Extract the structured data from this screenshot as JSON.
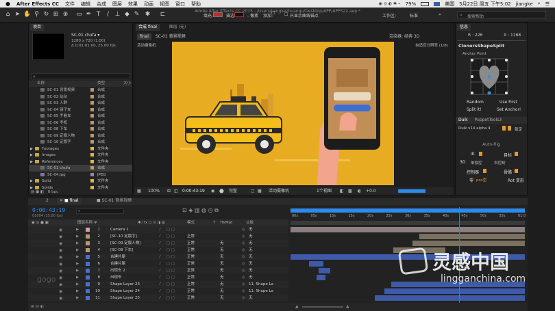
{
  "menubar": {
    "apple": "",
    "app": "After Effects CC",
    "items": [
      "文件",
      "编辑",
      "合成",
      "图层",
      "效果",
      "动画",
      "视图",
      "窗口",
      "帮助"
    ],
    "battery": "79%",
    "lang": "美国",
    "datetime": "5月22日 周五 下午5:02",
    "user": "jiangke"
  },
  "toolbar": {
    "doc_path": "Adobe After Effects CC 2015 - /Users/jiangkezhuanqu/Desktop/APP/APP522.aep *",
    "fill_label": "填充:",
    "stroke_label": "描边:",
    "stroke_px": "- 像素",
    "add_label": "添加:",
    "rtl_label": "只显示曲线锚点",
    "workspace_label": "工作区:",
    "workspace_value": "标准",
    "search_placeholder": "搜索帮助"
  },
  "project": {
    "tab": "项目",
    "comp_name": "SC-01 chufa ▾",
    "comp_res": "1280 x 720 (1.00)",
    "comp_dur": "Δ 0:01:01:00, 25.00 fps",
    "col_name": "名称",
    "col_type": "类型",
    "col_size": "大小",
    "items": [
      {
        "name": "SC-01 背景视频",
        "type": "合成",
        "color": "#b89a6d",
        "kind": "comp"
      },
      {
        "name": "SC-02 站台",
        "type": "合成",
        "color": "#b89a6d",
        "kind": "comp"
      },
      {
        "name": "SC-03 人群",
        "type": "合成",
        "color": "#b89a6d",
        "kind": "comp"
      },
      {
        "name": "SC-04 骑子女",
        "type": "合成",
        "color": "#b89a6d",
        "kind": "comp"
      },
      {
        "name": "SC-05 手看车",
        "type": "合成",
        "color": "#b89a6d",
        "kind": "comp"
      },
      {
        "name": "SC-06 手机",
        "type": "合成",
        "color": "#b89a6d",
        "kind": "comp"
      },
      {
        "name": "SC-08 下车",
        "type": "合成",
        "color": "#b89a6d",
        "kind": "comp"
      },
      {
        "name": "SC-09 定版人物",
        "type": "合成",
        "color": "#b89a6d",
        "kind": "comp"
      },
      {
        "name": "SC-10 定版字",
        "type": "合成",
        "color": "#b89a6d",
        "kind": "comp"
      },
      {
        "name": "Footages",
        "type": "文件夹",
        "color": "#d9b84c",
        "kind": "folder"
      },
      {
        "name": "Images",
        "type": "文件夹",
        "color": "#d9b84c",
        "kind": "folder"
      },
      {
        "name": "References",
        "type": "文件夹",
        "color": "#d9b84c",
        "kind": "folder"
      },
      {
        "name": "SC-01 chufa",
        "type": "合成",
        "color": "#b89a6d",
        "kind": "comp",
        "selected": true
      },
      {
        "name": "SC-04.jpg",
        "type": "JPEG",
        "color": "#8a8aa8",
        "kind": "file"
      },
      {
        "name": "Solid",
        "type": "文件夹",
        "color": "#d9b84c",
        "kind": "folder"
      },
      {
        "name": "Solids",
        "type": "文件夹",
        "color": "#d9b84c",
        "kind": "folder"
      }
    ],
    "bpc": "8 bpc"
  },
  "composition": {
    "tab_prefix": "合成",
    "tab_name": "final",
    "layer_tab": "图层 (无)",
    "chip": "final",
    "breadcrumb": "SC-01 背景视频",
    "renderer_label": "渲染器:",
    "renderer_value": "经典 3D",
    "camera": "活动摄像机",
    "resolution": "自适应分辨率 (1/8)",
    "zoom": "100%",
    "timecode": "0:00:43:19",
    "res": "完整",
    "view_camera": "活动摄像机",
    "views": "1个视图",
    "exposure": "+0.0"
  },
  "info": {
    "tab": "信息",
    "r": "R : 226",
    "x": "X : 1168"
  },
  "clonershape": {
    "title": "ClonersShapeSplit",
    "anchor_label": "Anchor Point",
    "random": "Random",
    "use_first": "Use First",
    "split_it": "Split it!",
    "set_anchor": "Set Anchor!"
  },
  "duik": {
    "tab_duik": "Duik",
    "tab_puppet": "PuppetTools3",
    "version": "Duik v14 alpha 4",
    "auto_rig": "Auto-Rig",
    "ik": "IK",
    "target": "目标",
    "three_d": "3D",
    "rig_left": "单独控",
    "rig_right": "右控制",
    "controller": "控制器",
    "bone": "骨骼",
    "zero": "零",
    "zero_label": "pos型",
    "rot_label": "Rot 变形"
  },
  "timeline": {
    "tabs": [
      "2",
      "final",
      "SC-01 背景视频"
    ],
    "active_tab": "final",
    "timecode": "0:00:43:19",
    "frame_info": "01094 (25.00 fps)",
    "col_layer": "图层名称",
    "col_mode": "模式",
    "col_t": "T",
    "col_trkmat": "TrkMat",
    "col_parent": "父级",
    "ruler": [
      "00s",
      "05s",
      "10s",
      "15s",
      "20s",
      "25s",
      "30s",
      "35s",
      "40s",
      "45s",
      "50s",
      "55s",
      "01:0"
    ],
    "playhead_fraction": 0.72,
    "layers": [
      {
        "n": "1",
        "name": "Camera 1",
        "label": "#d6a0b0",
        "mode": "",
        "trk": "",
        "parent": "无",
        "bar": [
          0.0,
          1.0
        ],
        "bar_color": "#8c7f80"
      },
      {
        "n": "2",
        "name": "[SC-10 定版字]",
        "label": "#b89a6d",
        "mode": "正常",
        "trk": "",
        "parent": "无",
        "bar": [
          0.55,
          1.0
        ],
        "bar_color": "#7a7060"
      },
      {
        "n": "3",
        "name": "[SC-09 定版人物]",
        "label": "#b89a6d",
        "mode": "正常",
        "trk": "无",
        "parent": "无",
        "bar": [
          0.52,
          1.0
        ],
        "bar_color": "#7a7060"
      },
      {
        "n": "4",
        "name": "[SC-08 下车]",
        "label": "#b89a6d",
        "mode": "正常",
        "trk": "无",
        "parent": "无",
        "bar": [
          0.44,
          0.66
        ],
        "bar_color": "#7a7060"
      },
      {
        "n": "5",
        "name": "合建片尾",
        "label": "#4a6fd0",
        "mode": "正常",
        "trk": "无",
        "parent": "无",
        "bar": [
          0.0,
          1.0
        ],
        "bar_color": "#3e5aa8"
      },
      {
        "n": "6",
        "name": "合建片尾",
        "label": "#4a6fd0",
        "mode": "正常",
        "trk": "无",
        "parent": "无",
        "bar": [
          0.08,
          0.14
        ],
        "bar_color": "#3e5aa8"
      },
      {
        "n": "7",
        "name": "出现车 2",
        "label": "#4a6fd0",
        "mode": "正常",
        "trk": "无",
        "parent": "无",
        "bar": [
          0.12,
          0.17
        ],
        "bar_color": "#3e5aa8"
      },
      {
        "n": "8",
        "name": "出现车",
        "label": "#4a6fd0",
        "mode": "正常",
        "trk": "无",
        "parent": "无",
        "bar": [
          0.11,
          0.15
        ],
        "bar_color": "#3e5aa8"
      },
      {
        "n": "9",
        "name": "Shape Layer 23",
        "label": "#4a6fd0",
        "mode": "正常",
        "trk": "无",
        "parent": "11. Shape La",
        "bar": [
          0.43,
          1.0
        ],
        "bar_color": "#3e5aa8"
      },
      {
        "n": "10",
        "name": "Shape Layer 24",
        "label": "#4a6fd0",
        "mode": "正常",
        "trk": "无",
        "parent": "11. Shape La",
        "bar": [
          0.4,
          1.0
        ],
        "bar_color": "#3e5aa8"
      },
      {
        "n": "11",
        "name": "Shape Layer 25",
        "label": "#4a6fd0",
        "mode": "正常",
        "trk": "无",
        "parent": "无",
        "bar": [
          0.36,
          1.0
        ],
        "bar_color": "#3e5aa8"
      }
    ]
  },
  "watermark": {
    "brand": "灵感中国",
    "url": "lingganchina.com",
    "left_mark": "gogo"
  },
  "colors": {
    "canvas_bg": "#e8ac22",
    "accent_blue": "#2d8ceb",
    "playhead": "#e0473b"
  }
}
